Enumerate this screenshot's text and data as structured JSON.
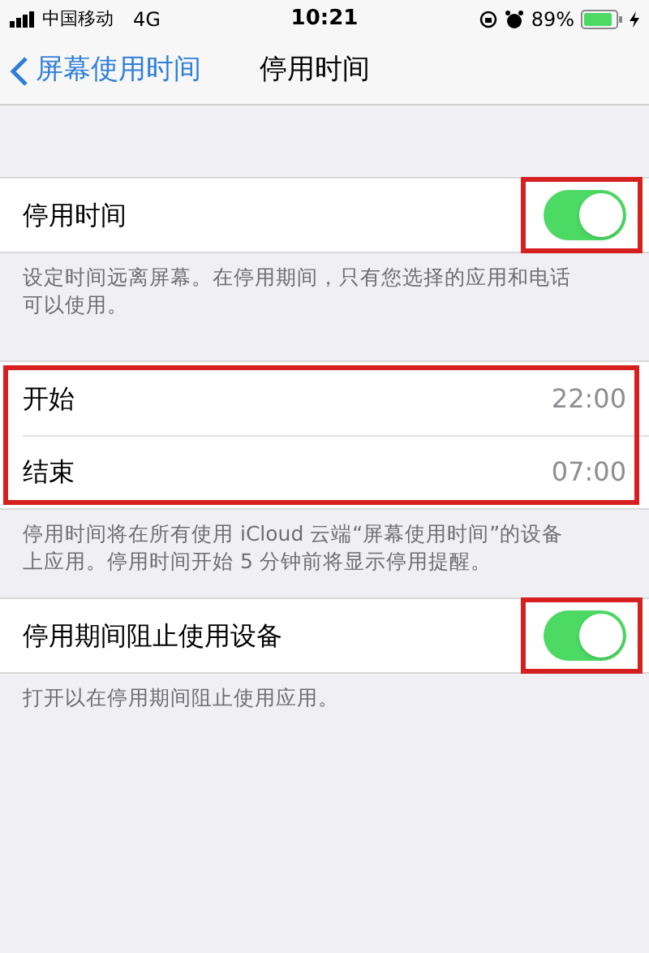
{
  "status_bar": {
    "carrier": "中国移动",
    "network": "4G",
    "time": "10:21",
    "battery": "89%",
    "charging": true
  },
  "nav": {
    "back": "屏幕使用时间",
    "title": "停用时间"
  },
  "sections": [
    {
      "kind": "toggle",
      "highlighted": true,
      "rows": [
        {
          "label": "停用时间",
          "on": true
        }
      ],
      "footer": "设定时间远离屏幕。在停用期间，只有您选择的应用和电话可以使用。"
    },
    {
      "kind": "values",
      "highlighted": true,
      "rows": [
        {
          "label": "开始",
          "value": "22:00"
        },
        {
          "label": "结束",
          "value": "07:00"
        }
      ],
      "footer": "停用时间将在所有使用 iCloud 云端“屏幕使用时间”的设备上应用。停用时间开始 5 分钟前将显示停用提醒。"
    },
    {
      "kind": "toggle",
      "highlighted": true,
      "rows": [
        {
          "label": "停用期间阻止使用设备",
          "on": true
        }
      ],
      "footer": "打开以在停用期间阻止使用应用。"
    }
  ]
}
